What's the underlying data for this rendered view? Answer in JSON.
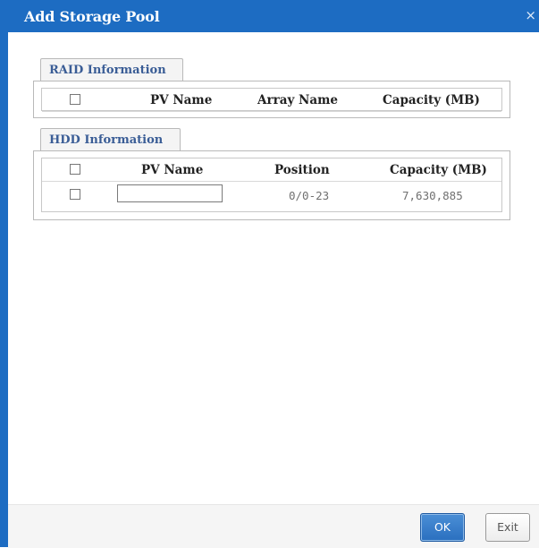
{
  "dialog": {
    "title": "Add Storage Pool",
    "close_glyph": "×"
  },
  "raid": {
    "tab_label": "RAID Information",
    "columns": [
      "PV Name",
      "Array Name",
      "Capacity (MB)"
    ]
  },
  "hdd": {
    "tab_label": "HDD Information",
    "columns": [
      "PV Name",
      "Position",
      "Capacity (MB)"
    ],
    "rows": [
      {
        "pv_name": "",
        "position": "0/0-23",
        "capacity": "7,630,885"
      }
    ]
  },
  "buttons": {
    "ok_label": "OK",
    "exit_label": "Exit"
  },
  "colors": {
    "titlebar": "#1d6cc2",
    "tab_text": "#3a5d96"
  }
}
